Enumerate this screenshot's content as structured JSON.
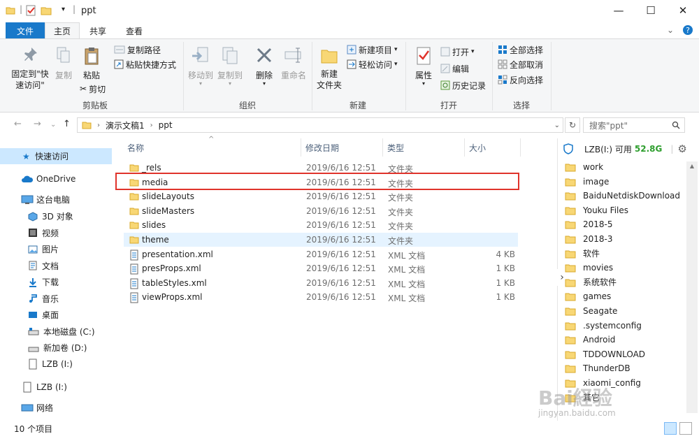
{
  "window": {
    "title": "ppt",
    "minimize": "—",
    "maximize": "☐",
    "close": "✕"
  },
  "tabs": {
    "file": "文件",
    "home": "主页",
    "share": "共享",
    "view": "查看"
  },
  "ribbon": {
    "clipboard": {
      "pin": "固定到\"快\n速访问\"",
      "copy": "复制",
      "paste": "粘贴",
      "cut": "剪切",
      "copy_path": "复制路径",
      "paste_shortcut": "粘贴快捷方式",
      "group": "剪贴板"
    },
    "organize": {
      "move_to": "移动到",
      "copy_to": "复制到",
      "delete": "删除",
      "rename": "重命名",
      "group": "组织"
    },
    "new": {
      "new_folder": "新建\n文件夹",
      "new_item": "新建项目",
      "easy_access": "轻松访问",
      "group": "新建"
    },
    "open": {
      "properties": "属性",
      "open": "打开",
      "edit": "编辑",
      "history": "历史记录",
      "group": "打开"
    },
    "select": {
      "select_all": "全部选择",
      "select_none": "全部取消",
      "invert": "反向选择",
      "group": "选择"
    }
  },
  "address": {
    "crumb1": "演示文稿1",
    "crumb2": "ppt",
    "search_placeholder": "搜索\"ppt\""
  },
  "nav": {
    "quick_access": "快速访问",
    "onedrive": "OneDrive",
    "this_pc": "这台电脑",
    "items": [
      "3D 对象",
      "视频",
      "图片",
      "文档",
      "下载",
      "音乐",
      "桌面",
      "本地磁盘 (C:)",
      "新加卷 (D:)",
      "LZB (I:)"
    ],
    "lzb": "LZB (I:)",
    "network": "网络"
  },
  "columns": {
    "name": "名称",
    "date": "修改日期",
    "type": "类型",
    "size": "大小"
  },
  "files": [
    {
      "name": "_rels",
      "date": "2019/6/16 12:51",
      "type": "文件夹",
      "size": "",
      "kind": "folder"
    },
    {
      "name": "media",
      "date": "2019/6/16 12:51",
      "type": "文件夹",
      "size": "",
      "kind": "folder"
    },
    {
      "name": "slideLayouts",
      "date": "2019/6/16 12:51",
      "type": "文件夹",
      "size": "",
      "kind": "folder"
    },
    {
      "name": "slideMasters",
      "date": "2019/6/16 12:51",
      "type": "文件夹",
      "size": "",
      "kind": "folder"
    },
    {
      "name": "slides",
      "date": "2019/6/16 12:51",
      "type": "文件夹",
      "size": "",
      "kind": "folder"
    },
    {
      "name": "theme",
      "date": "2019/6/16 12:51",
      "type": "文件夹",
      "size": "",
      "kind": "folder"
    },
    {
      "name": "presentation.xml",
      "date": "2019/6/16 12:51",
      "type": "XML 文档",
      "size": "4 KB",
      "kind": "xml"
    },
    {
      "name": "presProps.xml",
      "date": "2019/6/16 12:51",
      "type": "XML 文档",
      "size": "1 KB",
      "kind": "xml"
    },
    {
      "name": "tableStyles.xml",
      "date": "2019/6/16 12:51",
      "type": "XML 文档",
      "size": "1 KB",
      "kind": "xml"
    },
    {
      "name": "viewProps.xml",
      "date": "2019/6/16 12:51",
      "type": "XML 文档",
      "size": "1 KB",
      "kind": "xml"
    }
  ],
  "right_panel": {
    "drive": "LZB(I:) 可用",
    "free": "52.8G",
    "folders": [
      "work",
      "image",
      "BaiduNetdiskDownload",
      "Youku Files",
      "2018-5",
      "2018-3",
      "软件",
      "movies",
      "系统软件",
      "games",
      "Seagate",
      ".systemconfig",
      "Android",
      "TDDOWNLOAD",
      "ThunderDB",
      "xiaomi_config",
      "其它"
    ]
  },
  "status": {
    "count": "10 个项目"
  },
  "watermark": {
    "text": "Bai経验",
    "url": "jingyan.baidu.com"
  },
  "colors": {
    "accent": "#1979ca",
    "folder": "#f8d775",
    "selection": "#cce8ff",
    "highlight_box": "#e0332b",
    "free_space": "#2e9e2e"
  }
}
